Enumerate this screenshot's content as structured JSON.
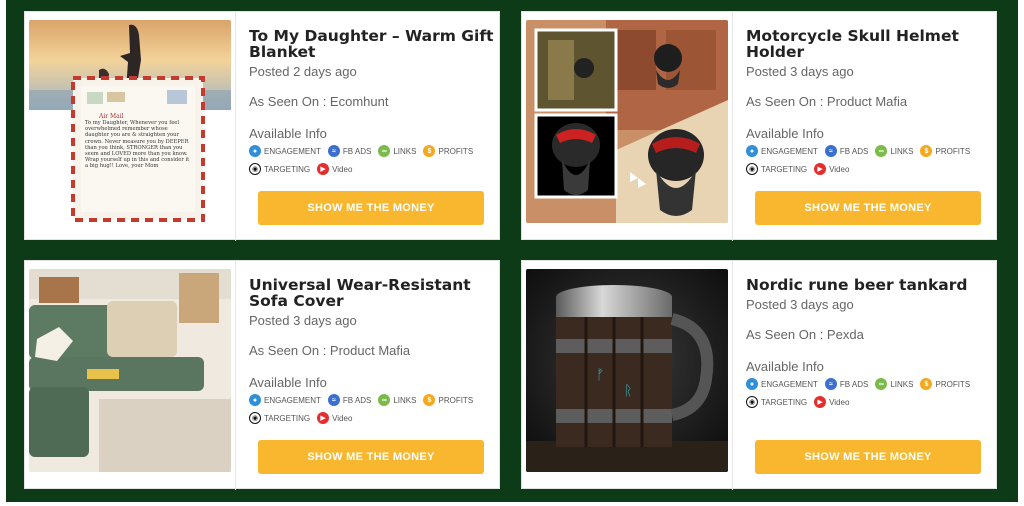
{
  "products": [
    {
      "title": "To My Daughter – Warm Gift Blanket",
      "posted": "Posted 2 days ago",
      "seen_on": "As Seen On : Ecomhunt",
      "available_info": "Available Info",
      "tags": [
        {
          "label": "ENGAGEMENT",
          "icon": "user-icon",
          "color": "#2f8fd8"
        },
        {
          "label": "FB ADS",
          "icon": "wifi-icon",
          "color": "#3b6fd0"
        },
        {
          "label": "LINKS",
          "icon": "link-icon",
          "color": "#7cba4a"
        },
        {
          "label": "PROFITS",
          "icon": "dollar-icon",
          "color": "#f3a81e"
        },
        {
          "label": "TARGETING",
          "icon": "target-icon",
          "color": "#111111"
        },
        {
          "label": "Video",
          "icon": "play-icon",
          "color": "#e52d2d"
        }
      ],
      "cta": "SHOW ME THE MONEY",
      "image_text": {
        "heading": "Air Mail",
        "body": "To my Daughter, Whenever you feel overwhelmed remember whose daughter you are & straighten your crown. Never measure you by DEEPER than you think, STRONGER than you seem and LOVED more than you know. Wrap yourself up in this and consider it a big hug!! Love, your Mom"
      }
    },
    {
      "title": "Motorcycle Skull Helmet Holder",
      "posted": "Posted 3 days ago",
      "seen_on": "As Seen On : Product Mafia",
      "available_info": "Available Info",
      "tags": [
        {
          "label": "ENGAGEMENT",
          "icon": "user-icon",
          "color": "#2f8fd8"
        },
        {
          "label": "FB ADS",
          "icon": "wifi-icon",
          "color": "#3b6fd0"
        },
        {
          "label": "LINKS",
          "icon": "link-icon",
          "color": "#7cba4a"
        },
        {
          "label": "PROFITS",
          "icon": "dollar-icon",
          "color": "#f3a81e"
        },
        {
          "label": "TARGETING",
          "icon": "target-icon",
          "color": "#111111"
        },
        {
          "label": "Video",
          "icon": "play-icon",
          "color": "#e52d2d"
        }
      ],
      "cta": "SHOW ME THE MONEY"
    },
    {
      "title": "Universal Wear-Resistant Sofa Cover",
      "posted": "Posted 3 days ago",
      "seen_on": "As Seen On : Product Mafia",
      "available_info": "Available Info",
      "tags": [
        {
          "label": "ENGAGEMENT",
          "icon": "user-icon",
          "color": "#2f8fd8"
        },
        {
          "label": "FB ADS",
          "icon": "wifi-icon",
          "color": "#3b6fd0"
        },
        {
          "label": "LINKS",
          "icon": "link-icon",
          "color": "#7cba4a"
        },
        {
          "label": "PROFITS",
          "icon": "dollar-icon",
          "color": "#f3a81e"
        },
        {
          "label": "TARGETING",
          "icon": "target-icon",
          "color": "#111111"
        },
        {
          "label": "Video",
          "icon": "play-icon",
          "color": "#e52d2d"
        }
      ],
      "cta": "SHOW ME THE MONEY"
    },
    {
      "title": "Nordic rune beer tankard",
      "posted": "Posted 3 days ago",
      "seen_on": "As Seen On : Pexda",
      "available_info": "Available Info",
      "tags": [
        {
          "label": "ENGAGEMENT",
          "icon": "user-icon",
          "color": "#2f8fd8"
        },
        {
          "label": "FB ADS",
          "icon": "wifi-icon",
          "color": "#3b6fd0"
        },
        {
          "label": "LINKS",
          "icon": "link-icon",
          "color": "#7cba4a"
        },
        {
          "label": "PROFITS",
          "icon": "dollar-icon",
          "color": "#f3a81e"
        },
        {
          "label": "TARGETING",
          "icon": "target-icon",
          "color": "#111111"
        },
        {
          "label": "Video",
          "icon": "play-icon",
          "color": "#e52d2d"
        }
      ],
      "cta": "SHOW ME THE MONEY"
    }
  ],
  "colors": {
    "background": "#0d3b17",
    "card": "#ffffff",
    "button": "#f8b72f",
    "title": "#222222",
    "meta": "#666666"
  }
}
